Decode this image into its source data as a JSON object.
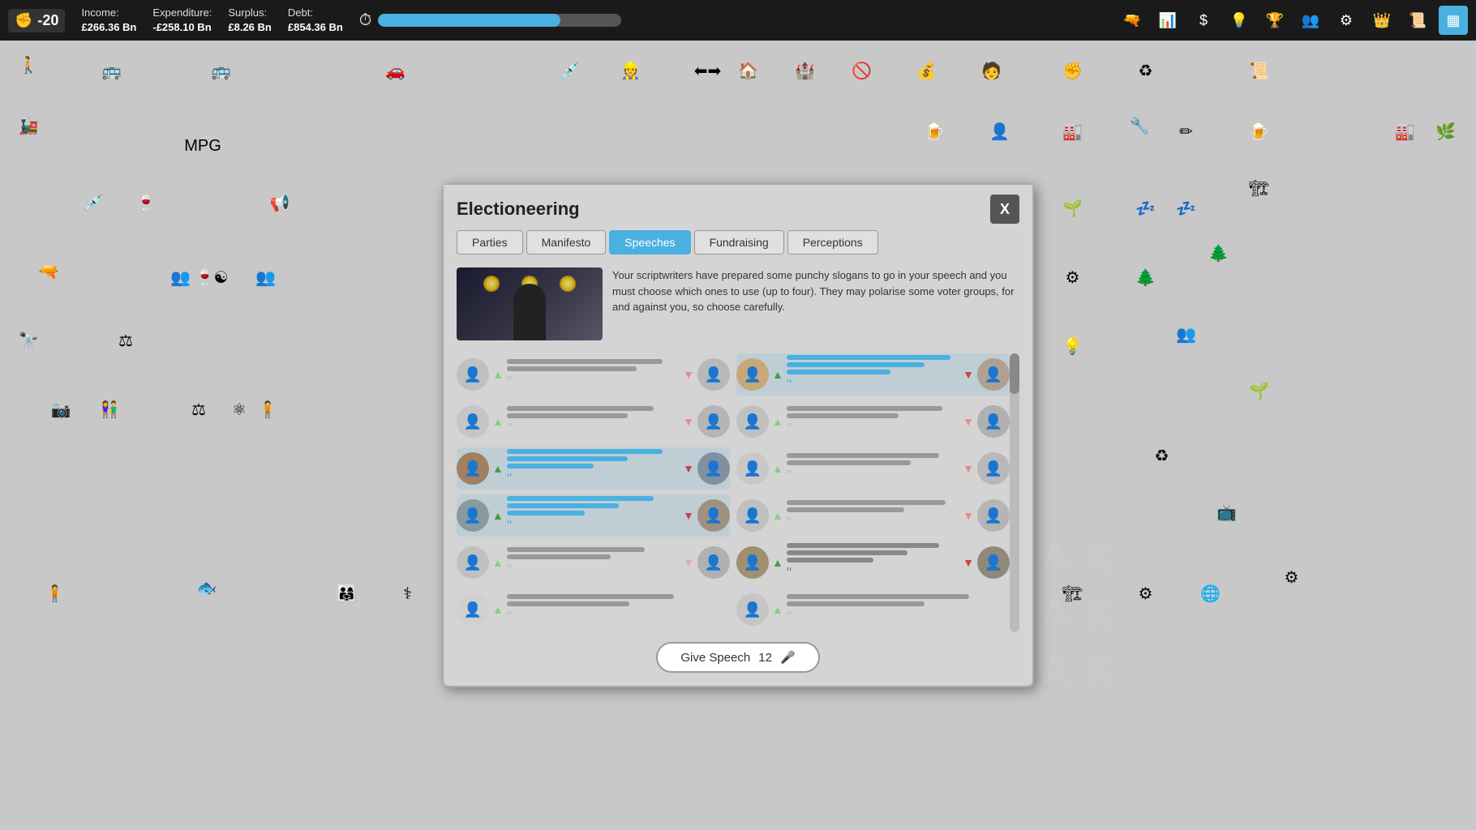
{
  "topbar": {
    "score": "-20",
    "income_label": "Income:",
    "income_value": "£266.36 Bn",
    "expenditure_label": "Expenditure:",
    "expenditure_value": "-£258.10 Bn",
    "surplus_label": "Surplus:",
    "surplus_value": "£8.26 Bn",
    "debt_label": "Debt:",
    "debt_value": "£854.36 Bn",
    "progress_pct": 75
  },
  "modal": {
    "title": "Electioneering",
    "close_label": "X",
    "tabs": [
      "Parties",
      "Manifesto",
      "Speeches",
      "Fundraising",
      "Perceptions"
    ],
    "active_tab": "Speeches",
    "description": "Your scriptwriters have prepared some punchy slogans to go in your speech and you must choose which ones to use (up to four). They may polarise some voter groups, for and against you, so choose carefully.",
    "give_speech_label": "Give Speech",
    "give_speech_count": "12"
  },
  "icons": {
    "up_arrow": "▲",
    "down_arrow": "▼",
    "quote_open": "“",
    "quote_close": "”",
    "fist": "✊",
    "gun": "🔫",
    "chart": "📊",
    "dollar": "$",
    "bulb": "💡",
    "trophy": "🏆",
    "people": "👥",
    "gear": "⚙",
    "crown": "👑",
    "scroll": "📜",
    "grid": "▦"
  }
}
